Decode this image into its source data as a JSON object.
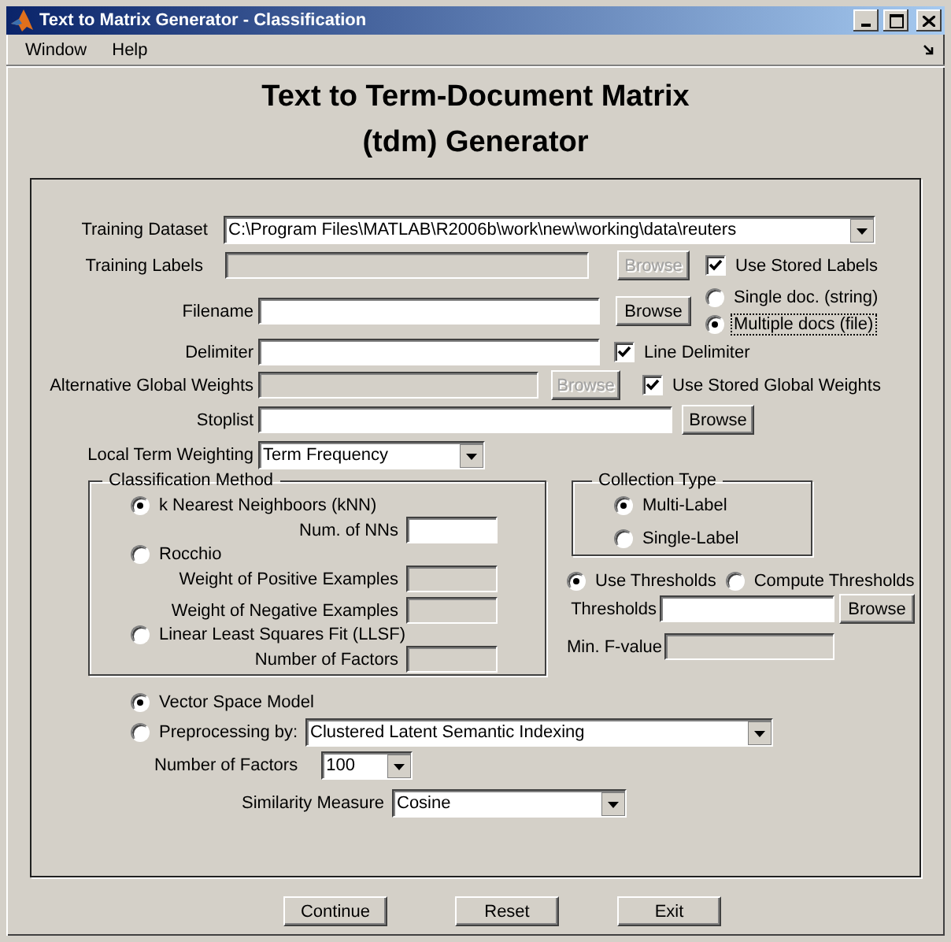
{
  "window": {
    "title": "Text to Matrix Generator - Classification"
  },
  "menu": [
    "Window",
    "Help"
  ],
  "heading": [
    "Text to Term-Document Matrix",
    "(tdm) Generator"
  ],
  "training_dataset": {
    "label": "Training Dataset",
    "value": "C:\\Program Files\\MATLAB\\R2006b\\work\\new\\working\\data\\reuters"
  },
  "training_labels": {
    "label": "Training Labels",
    "disabled": true,
    "browse": "Browse",
    "checkbox": {
      "label": "Use Stored Labels",
      "checked": true
    }
  },
  "input_mode": [
    {
      "label": "Single doc. (string)",
      "selected": false
    },
    {
      "label": "Multiple docs (file)",
      "selected": true
    }
  ],
  "filename": {
    "label": "Filename",
    "browse": "Browse"
  },
  "delimiter": {
    "label": "Delimiter",
    "checkbox": {
      "label": "Line Delimiter",
      "checked": true
    }
  },
  "global_weights": {
    "label": "Alternative Global Weights",
    "disabled": true,
    "browse": "Browse",
    "checkbox": {
      "label": "Use Stored Global Weights",
      "checked": true
    }
  },
  "stoplist": {
    "label": "Stoplist",
    "browse": "Browse"
  },
  "local_term_weighting": {
    "label": "Local Term Weighting",
    "value": "Term Frequency"
  },
  "classification_method": {
    "title": "Classification Method",
    "methods": [
      {
        "label": "k Nearest Neighboors (kNN)",
        "selected": true,
        "params": [
          {
            "label": "Num. of NNs",
            "disabled": false
          }
        ]
      },
      {
        "label": "Rocchio",
        "selected": false,
        "params": [
          {
            "label": "Weight of Positive Examples",
            "disabled": true
          },
          {
            "label": "Weight of Negative Examples",
            "disabled": true
          }
        ]
      },
      {
        "label": "Linear Least Squares Fit (LLSF)",
        "selected": false,
        "params": [
          {
            "label": "Number of Factors",
            "disabled": true
          }
        ]
      }
    ]
  },
  "collection_type": {
    "title": "Collection Type",
    "options": [
      {
        "label": "Multi-Label",
        "selected": true
      },
      {
        "label": "Single-Label",
        "selected": false
      }
    ]
  },
  "threshold_mode": [
    {
      "label": "Use Thresholds",
      "selected": true
    },
    {
      "label": "Compute Thresholds",
      "selected": false
    }
  ],
  "thresholds": {
    "label": "Thresholds",
    "browse": "Browse",
    "disabled": false
  },
  "min_f_value": {
    "label": "Min. F-value",
    "disabled": true
  },
  "model": [
    {
      "label": "Vector Space Model",
      "selected": true
    },
    {
      "label": "Preprocessing by:",
      "selected": false,
      "value": "Clustered Latent Semantic Indexing"
    }
  ],
  "number_of_factors": {
    "label": "Number of Factors",
    "value": "100"
  },
  "similarity_measure": {
    "label": "Similarity Measure",
    "value": "Cosine"
  },
  "buttons": [
    "Continue",
    "Reset",
    "Exit"
  ]
}
